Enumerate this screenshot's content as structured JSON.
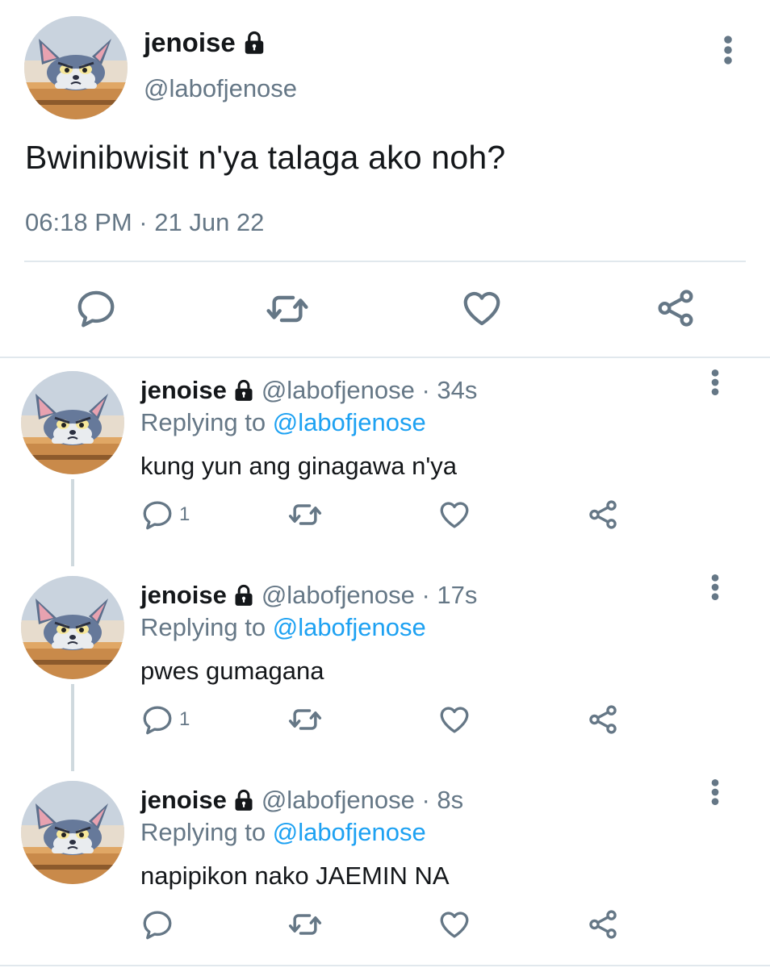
{
  "tweet": {
    "name": "jenoise",
    "handle": "@labofjenose",
    "text": "Bwinibwisit n'ya talaga ako noh?",
    "timestamp": "06:18 PM · 21 Jun 22"
  },
  "replies": [
    {
      "name": "jenoise",
      "meta": "@labofjenose · 34s",
      "replying_prefix": "Replying to ",
      "replying_to": "@labofjenose",
      "text": "kung yun ang ginagawa n'ya",
      "reply_count": "1"
    },
    {
      "name": "jenoise",
      "meta": "@labofjenose · 17s",
      "replying_prefix": "Replying to ",
      "replying_to": "@labofjenose",
      "text": "pwes gumagana",
      "reply_count": "1"
    },
    {
      "name": "jenoise",
      "meta": "@labofjenose · 8s",
      "replying_prefix": "Replying to ",
      "replying_to": "@labofjenose",
      "text": "napipikon nako JAEMIN NA",
      "reply_count": ""
    }
  ],
  "icons": {
    "lock": "lock-icon",
    "more": "more-vertical-icon",
    "reply": "reply-icon",
    "retweet": "retweet-icon",
    "like": "heart-icon",
    "share": "share-icon"
  },
  "colors": {
    "text": "#14171a",
    "secondary": "#657786",
    "link": "#1da1f2",
    "divider": "#e1e8ed"
  }
}
